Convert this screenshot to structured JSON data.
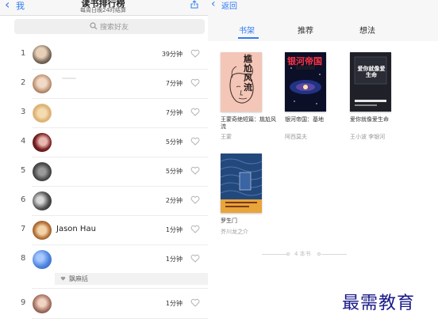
{
  "left_panel": {
    "back_label": "我",
    "title": "读书排行榜",
    "subtitle": "每周日晚24时结算",
    "search_placeholder": "搜索好友",
    "rows": [
      {
        "rank": "1",
        "name": "",
        "duration": "39分钟"
      },
      {
        "rank": "2",
        "name": "",
        "duration": "7分钟"
      },
      {
        "rank": "3",
        "name": "",
        "duration": "7分钟"
      },
      {
        "rank": "4",
        "name": "",
        "duration": "5分钟"
      },
      {
        "rank": "5",
        "name": "",
        "duration": "5分钟"
      },
      {
        "rank": "6",
        "name": "",
        "duration": "2分钟"
      },
      {
        "rank": "7",
        "name": "Jason Hau",
        "duration": "1分钟"
      },
      {
        "rank": "8",
        "name": "",
        "duration": "1分钟"
      },
      {
        "rank": "9",
        "name": "",
        "duration": "1分钟"
      }
    ],
    "like_name": "飘麻括"
  },
  "right_panel": {
    "back_label": "返回",
    "tabs": [
      "书架",
      "推荐",
      "想法"
    ],
    "active_tab": "书架",
    "books": [
      {
        "title": "王蒙奇绝短篇：尴尬风流",
        "author": "王蒙",
        "cover_text": "尴尬风流"
      },
      {
        "title": "银河帝国：基地",
        "author": "阿西莫夫",
        "cover_text": "银河帝国"
      },
      {
        "title": "爱你就像爱生命",
        "author": "王小波 李银河",
        "cover_text": "爱你就像爱生命"
      },
      {
        "title": "罗生门",
        "author": "芥川龙之介",
        "cover_text": ""
      }
    ],
    "book_count": "4 本书"
  },
  "watermark": "最需教育",
  "colors": {
    "accent": "#2f7bf6",
    "watermark": "#1a1a8a"
  },
  "icons": {
    "back": "chevron-left-icon",
    "share": "share-icon",
    "search": "search-icon",
    "like": "heart-icon"
  }
}
